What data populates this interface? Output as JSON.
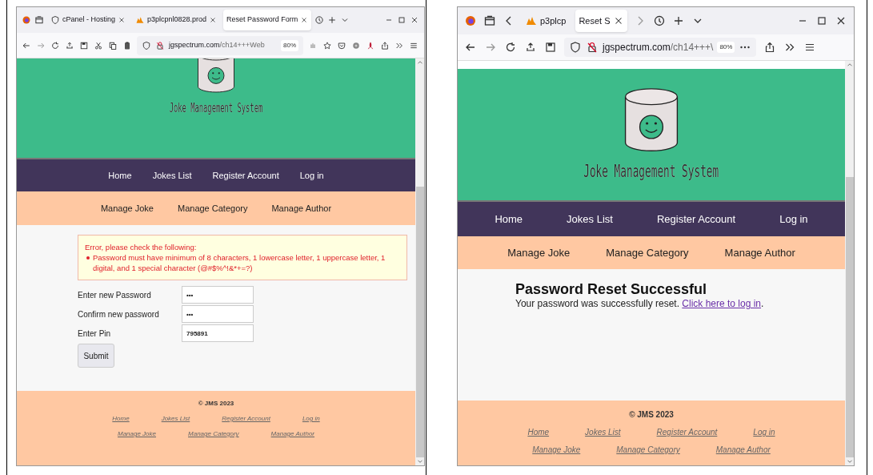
{
  "windows": [
    {
      "tabs": [
        {
          "label": "cPanel - Hosting",
          "selected": false,
          "closable": true
        },
        {
          "label": "p3plcpnl0828.prod",
          "selected": false,
          "closable": true
        },
        {
          "label": "Reset Password Form",
          "selected": true,
          "closable": true
        }
      ],
      "url_host": "jgspectrum.com",
      "url_path": "/ch14+++Web",
      "zoom": "80%",
      "site_title": "Joke Management System",
      "nav": [
        "Home",
        "Jokes List",
        "Register Account",
        "Log in"
      ],
      "subnav": [
        "Manage Joke",
        "Manage Category",
        "Manage Author"
      ],
      "content": {
        "kind": "form",
        "error_title": "Error, please check the following:",
        "errors": [
          "Password must have minimum of 8 characters, 1 lowercase letter, 1 uppercase letter, 1 digital, and 1 special character (@#$%^!&*+=?)"
        ],
        "fields": [
          {
            "label": "Enter new Password",
            "value": "•••"
          },
          {
            "label": "Confirm new password",
            "value": "•••"
          },
          {
            "label": "Enter Pin",
            "value": "795891"
          }
        ],
        "submit": "Submit"
      },
      "footer": {
        "copyright": "© JMS 2023",
        "links": [
          [
            "Home",
            "Jokes List",
            "Register Account",
            "Log in"
          ],
          [
            "Manage Joke",
            "Manage Category",
            "Manage Author"
          ]
        ]
      }
    },
    {
      "tabs": [
        {
          "label": "p3plcp",
          "selected": false,
          "closable": false
        },
        {
          "label": "Reset S",
          "selected": true,
          "closable": true
        }
      ],
      "url_host": "jgspectrum.com",
      "url_path": "/ch14+++\\",
      "zoom": "80%",
      "site_title": "Joke Management System",
      "nav": [
        "Home",
        "Jokes List",
        "Register Account",
        "Log in"
      ],
      "subnav": [
        "Manage Joke",
        "Manage Category",
        "Manage Author"
      ],
      "content": {
        "kind": "message",
        "heading": "Password Reset Successful",
        "text": "Your password was successfully reset.",
        "link": "Click here to log in",
        "after": "."
      },
      "footer": {
        "copyright": "© JMS 2023",
        "links": [
          [
            "Home",
            "Jokes List",
            "Register Account",
            "Log in"
          ],
          [
            "Manage Joke",
            "Manage Category",
            "Manage Author"
          ]
        ]
      }
    }
  ]
}
